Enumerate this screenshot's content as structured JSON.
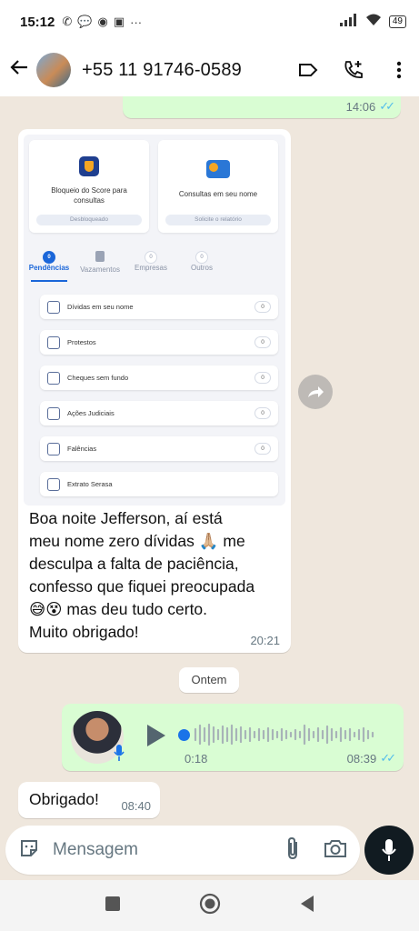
{
  "status_bar": {
    "time": "15:12",
    "battery": "49"
  },
  "header": {
    "contact": "+55 11 91746-0589"
  },
  "first_outgoing": {
    "time": "14:06"
  },
  "shot": {
    "card_left": {
      "title": "Bloqueio do Score para consultas",
      "pill": "Desbloqueado"
    },
    "card_right": {
      "title": "Consultas em seu nome",
      "pill": "Solicite o relatório"
    },
    "tabs": [
      {
        "label": "Pendências",
        "badge": "0"
      },
      {
        "label": "Vazamentos",
        "badge": ""
      },
      {
        "label": "Empresas",
        "badge": "0"
      },
      {
        "label": "Outros",
        "badge": "0"
      }
    ],
    "rows": [
      {
        "label": "Dívidas em seu nome",
        "count": "0"
      },
      {
        "label": "Protestos",
        "count": "0"
      },
      {
        "label": "Cheques sem fundo",
        "count": "0"
      },
      {
        "label": "Ações Judiciais",
        "count": "0"
      },
      {
        "label": "Falências",
        "count": "0"
      },
      {
        "label": "Extrato Serasa",
        "count": ""
      }
    ]
  },
  "incoming_message": {
    "lines": [
      "Boa noite Jefferson, aí está",
      "meu nome zero dívidas 🙏🏼 me",
      "desculpa a falta de paciência,",
      "confesso que fiquei preocupada",
      "😅😵 mas deu tudo certo.",
      "Muito obrigado!"
    ],
    "time": "20:21"
  },
  "date_chip": "Ontem",
  "voice_message": {
    "duration": "0:18",
    "time": "08:39"
  },
  "last_message": {
    "text": "Obrigado!",
    "time": "08:40"
  },
  "input": {
    "placeholder": "Mensagem"
  }
}
